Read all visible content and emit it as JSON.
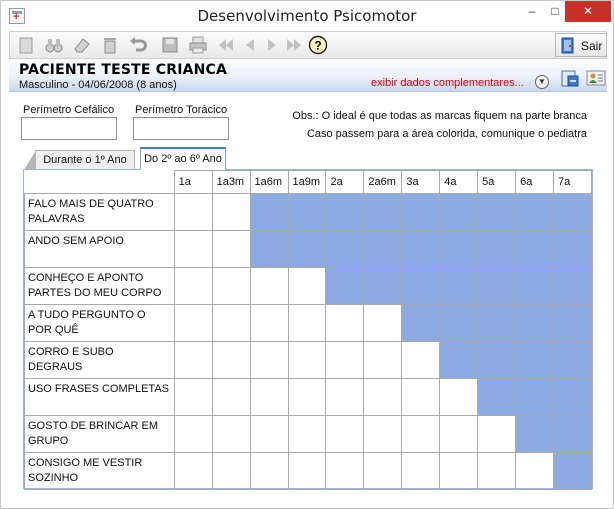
{
  "window": {
    "title": "Desenvolvimento Psicomotor",
    "minimize": "–",
    "maximize": "□",
    "close": "✕"
  },
  "toolbar": {
    "icons": [
      "new-icon",
      "binoculars-icon",
      "eraser-icon",
      "trash-icon",
      "undo-icon",
      "save-icon",
      "print-icon",
      "first-icon",
      "prev-icon",
      "next-icon",
      "last-icon",
      "help-icon"
    ],
    "exit_label": "Sair"
  },
  "patient": {
    "name": "PACIENTE TESTE CRIANCA",
    "info": "Masculino - 04/06/2008 (8 anos)",
    "extra_link": "exibir dados complementares..."
  },
  "fields": {
    "head_label": "Perímetro Cefálico",
    "head_value": "",
    "chest_label": "Perímetro Torácico",
    "chest_value": ""
  },
  "obs": {
    "line1": "Obs.: O ideal é que todas as marcas fiquem na parte branca",
    "line2": "Caso passem para a área colorida, comunique o pediatra"
  },
  "tabs": [
    {
      "label": "Durante o 1º Ano",
      "active": false
    },
    {
      "label": "Do 2º ao 6º Ano",
      "active": true
    }
  ],
  "grid": {
    "fill_color": "#8dabe3",
    "columns": [
      "1a",
      "1a3m",
      "1a6m",
      "1a9m",
      "2a",
      "2a6m",
      "3a",
      "4a",
      "5a",
      "6a",
      "7a"
    ],
    "rows": [
      {
        "label": "FALO MAIS DE QUATRO PALAVRAS",
        "filled_from": 2
      },
      {
        "label": "ANDO SEM APOIO",
        "filled_from": 2
      },
      {
        "label": "CONHEÇO E APONTO PARTES DO MEU CORPO",
        "filled_from": 4
      },
      {
        "label": "A TUDO PERGUNTO O POR QUÊ",
        "filled_from": 6
      },
      {
        "label": "CORRO E SUBO DEGRAUS",
        "filled_from": 7
      },
      {
        "label": "USO FRASES COMPLETAS",
        "filled_from": 8
      },
      {
        "label": "GOSTO DE BRINCAR EM GRUPO",
        "filled_from": 9
      },
      {
        "label": "CONSIGO ME VESTIR SOZINHO",
        "filled_from": 10
      }
    ]
  }
}
